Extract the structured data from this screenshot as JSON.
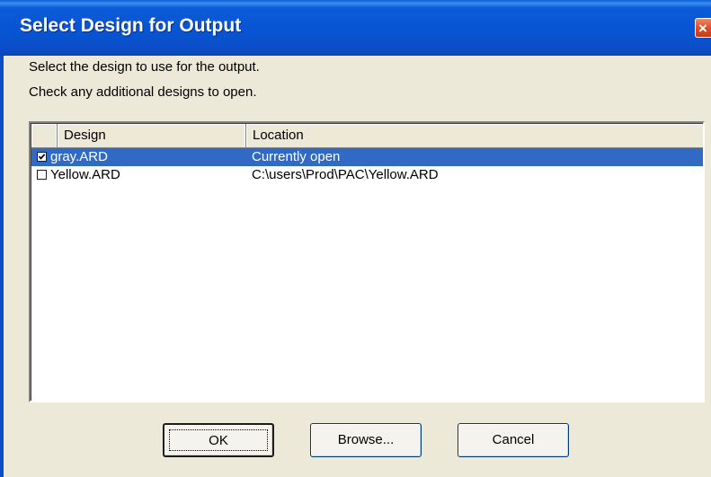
{
  "window": {
    "title": "Select Design for Output",
    "close_label": "×"
  },
  "instructions": {
    "line1": "Select the design to use for the output.",
    "line2": "Check any additional designs to open."
  },
  "list": {
    "columns": [
      "",
      "Design",
      "Location"
    ],
    "rows": [
      {
        "checked": true,
        "selected": true,
        "design": "gray.ARD",
        "location": "Currently open"
      },
      {
        "checked": false,
        "selected": false,
        "design": "Yellow.ARD",
        "location": "C:\\users\\Prod\\PAC\\Yellow.ARD"
      }
    ]
  },
  "buttons": {
    "ok": "OK",
    "browse": "Browse...",
    "cancel": "Cancel"
  },
  "colors": {
    "selection": "#316ac5",
    "titlebar": "#0854d3",
    "dialog_bg": "#ece9d8"
  }
}
